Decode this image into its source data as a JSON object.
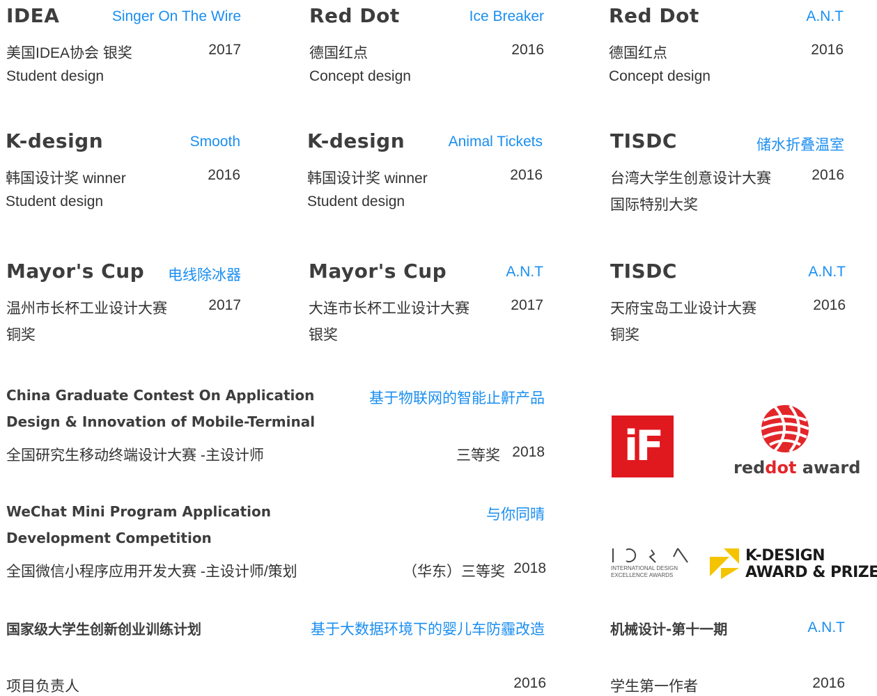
{
  "cards": [
    {
      "title": "IDEA",
      "project": "Singer On The Wire",
      "award": "美国IDEA协会 银奖",
      "year": "2017",
      "category": "Student design"
    },
    {
      "title": "Red Dot",
      "project": "Ice Breaker",
      "award": "德国红点",
      "year": "2016",
      "category": "Concept design"
    },
    {
      "title": "Red Dot",
      "project": "A.N.T",
      "award": "德国红点",
      "year": "2016",
      "category": "Concept design"
    },
    {
      "title": "K-design",
      "project": "Smooth",
      "award": "韩国设计奖 winner",
      "year": "2016",
      "category": "Student design"
    },
    {
      "title": "K-design",
      "project": "Animal Tickets",
      "award": "韩国设计奖 winner",
      "year": "2016",
      "category": "Student design"
    },
    {
      "title": "TISDC",
      "project": "储水折叠温室",
      "award": "台湾大学生创意设计大赛",
      "year": "2016",
      "category": "国际特别大奖"
    },
    {
      "title": "Mayor's Cup",
      "project": "电线除冰器",
      "award": "温州市长杯工业设计大赛",
      "year": "2017",
      "category": "铜奖"
    },
    {
      "title": "Mayor's Cup",
      "project": "A.N.T",
      "award": "大连市长杯工业设计大赛",
      "year": "2017",
      "category": "银奖"
    },
    {
      "title": "TISDC",
      "project": "A.N.T",
      "award": "天府宝岛工业设计大赛",
      "year": "2016",
      "category": "铜奖"
    }
  ],
  "contests": [
    {
      "title_line1": "China Graduate Contest On Application",
      "title_line2": "Design & Innovation of Mobile-Terminal",
      "project": "基于物联网的智能止鼾产品",
      "desc": "全国研究生移动终端设计大赛 -主设计师",
      "result": "三等奖",
      "year": "2018"
    },
    {
      "title_line1": "WeChat Mini Program Application",
      "title_line2": "Development Competition",
      "project": "与你同晴",
      "desc": "全国微信小程序应用开发大赛 -主设计师/策划",
      "result": "（华东）三等奖",
      "year": "2018"
    },
    {
      "title": "国家级大学生创新创业训练计划",
      "project": "基于大数据环境下的婴儿车防霾改造",
      "desc": "项目负责人",
      "year": "2016"
    }
  ],
  "paper": {
    "title": "机械设计-第十一期",
    "project": "A.N.T",
    "desc": "学生第一作者",
    "year": "2016"
  },
  "logos": {
    "if_text": "iF",
    "reddot_text_a": "red",
    "reddot_text_b": "dot",
    "reddot_text_c": " award",
    "idea_line1": "INTERNATIONAL DESIGN",
    "idea_line2": "EXCELLENCE AWARDS",
    "kdesign_line1": "K-DESIGN",
    "kdesign_line2": "AWARD & PRIZE"
  },
  "colors": {
    "accent": "#1a8ef0",
    "title": "#3d3d3d",
    "text": "#333333",
    "if_red": "#e0191f",
    "reddot_red": "#e3262a",
    "kdesign_yellow": "#f5c400"
  }
}
